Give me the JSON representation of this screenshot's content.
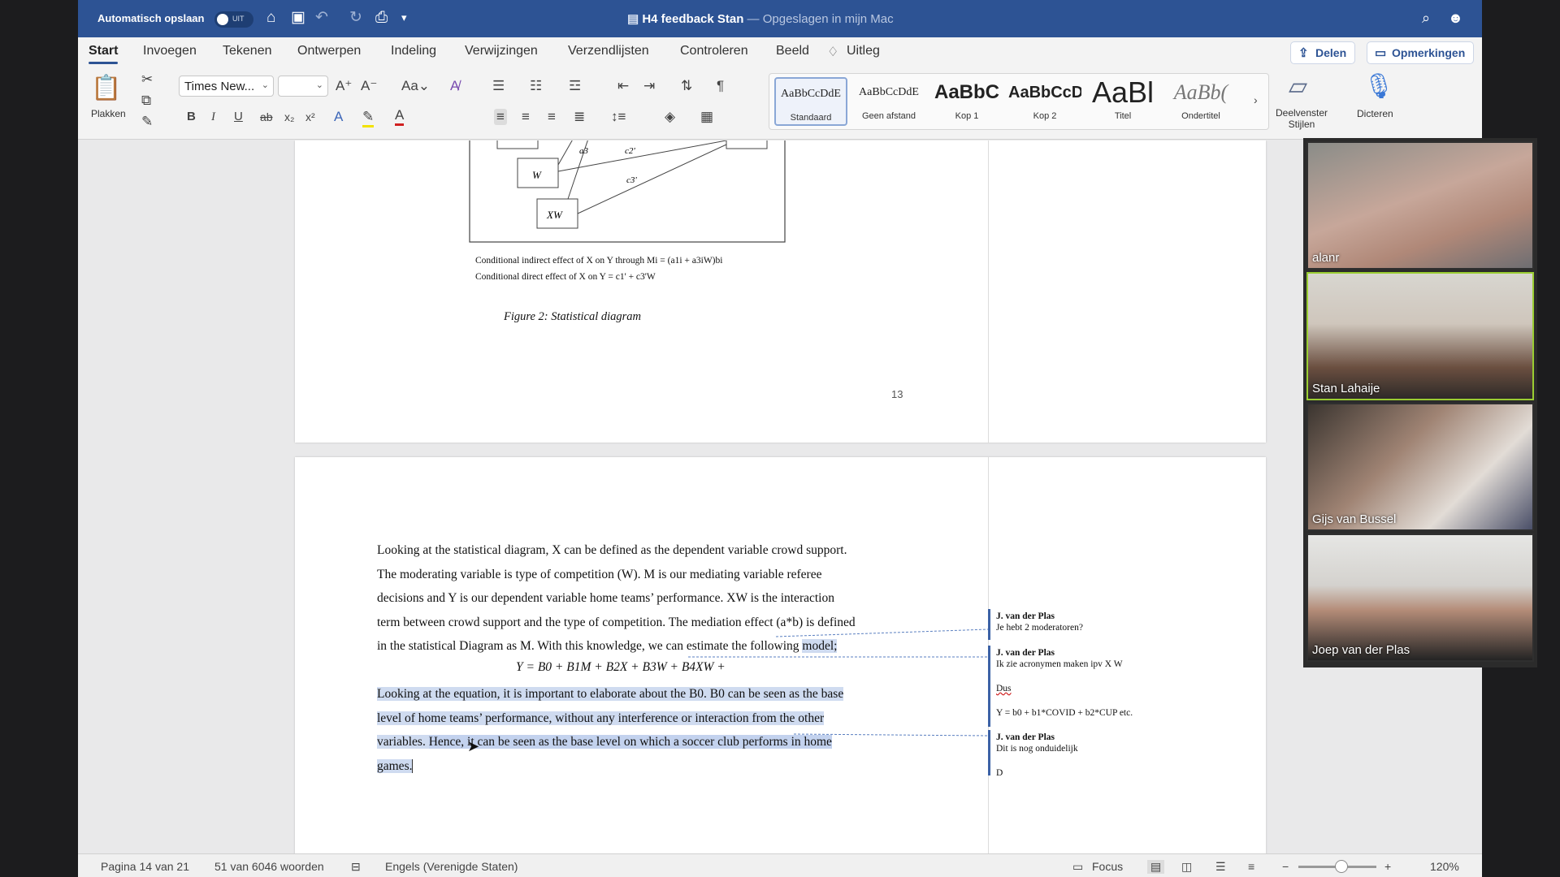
{
  "titlebar": {
    "autosave_label": "Automatisch opslaan",
    "toggle_text": "UIT",
    "doc_title": "H4 feedback Stan",
    "doc_status": " — Opgeslagen in mijn Mac"
  },
  "tabs": [
    "Start",
    "Invoegen",
    "Tekenen",
    "Ontwerpen",
    "Indeling",
    "Verwijzingen",
    "Verzendlijsten",
    "Controleren",
    "Beeld",
    "Uitleg"
  ],
  "share_label": "Delen",
  "comments_label": "Opmerkingen",
  "ribbon": {
    "paste_label": "Plakken",
    "font_name": "Times New...",
    "font_size": "",
    "styles": [
      {
        "preview": "AaBbCcDdE",
        "name": "Standaard"
      },
      {
        "preview": "AaBbCcDdE",
        "name": "Geen afstand"
      },
      {
        "preview": "AaBbC",
        "name": "Kop 1"
      },
      {
        "preview": "AaBbCcD",
        "name": "Kop 2"
      },
      {
        "preview": "AaBl",
        "name": "Titel"
      },
      {
        "preview": "AaBb(",
        "name": "Ondertitel"
      }
    ],
    "styles_pane_label": "Deelvenster Stijlen",
    "dictate_label": "Dicteren"
  },
  "page1": {
    "diagram_labels": {
      "w": "W",
      "xw": "XW",
      "a3": "a3",
      "c2": "c2'",
      "c3": "c3'"
    },
    "caption1": "Conditional indirect effect of X on Y through Mi = (a1i + a3iW)bi",
    "caption2": "Conditional direct effect of X on Y = c1' + c3'W",
    "figure_title": "Figure 2: Statistical diagram",
    "page_number": "13"
  },
  "page2": {
    "para1_lines": [
      "Looking at the statistical diagram, X can be defined as the dependent variable crowd support.",
      "The moderating variable is type of competition (W). M is our mediating variable referee",
      "decisions and Y is our dependent variable home teams’ performance. XW is the interaction",
      "term between crowd support and the type of competition. The mediation effect (a*b) is defined"
    ],
    "para1_last_pre": "in the statistical Diagram as M. With this knowledge, we can estimate the following ",
    "para1_last_hl": "model;",
    "equation": "Y = B0 + B1M + B2X + B3W + B4XW +",
    "para2_line1": "Looking at the equation, it is important to elaborate about the B0. B0 can be seen as the base",
    "para2_line2": "level of home teams’ performance, without any interference or interaction from the other",
    "para2_line3_pre": "variables. ",
    "para2_line3_hl": "Hence, it can be seen as the base level on which a soccer club performs in home",
    "para2_line4": "games. "
  },
  "comments": [
    {
      "author": "J. van der Plas",
      "text": "Je hebt 2 moderatoren?"
    },
    {
      "author": "J. van der Plas",
      "text": "Ik zie acronymen maken ipv X W",
      "extra1": "Dus",
      "extra2": "Y = b0 + b1*COVID + b2*CUP etc."
    },
    {
      "author": "J. van der Plas",
      "text": "Dit is nog onduidelijk",
      "extra1": "D"
    }
  ],
  "status": {
    "page": "Pagina 14 van 21",
    "words": "51 van 6046 woorden",
    "language": "Engels (Verenigde Staten)",
    "focus": "Focus",
    "zoom": "120%",
    "zoom_level": 0.55
  },
  "participants": [
    "alanr",
    "Stan Lahaije",
    "Gijs van Bussel",
    "Joep van der Plas"
  ],
  "colors": {
    "titlebar": "#2d5394",
    "highlight": "#cfdbf0",
    "comment_bar": "#3c62a6"
  }
}
